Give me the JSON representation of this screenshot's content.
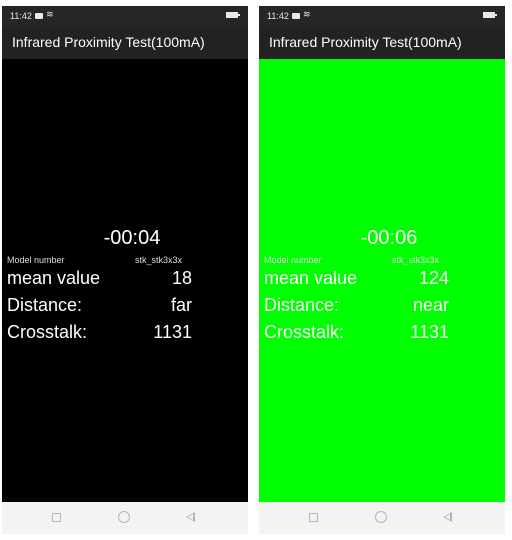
{
  "screens": [
    {
      "status_time": "11:42",
      "title": "Infrared Proximity Test(100mA)",
      "background_color": "#000000",
      "timer": "-00:04",
      "model_label": "Model number",
      "model_value": "stk_stk3x3x",
      "mean_label": "mean value",
      "mean_value": "18",
      "distance_label": "Distance:",
      "distance_value": "far",
      "crosstalk_label": "Crosstalk:",
      "crosstalk_value": "1131"
    },
    {
      "status_time": "11:42",
      "title": "Infrared Proximity Test(100mA)",
      "background_color": "#00ff00",
      "timer": "-00:06",
      "model_label": "Model number",
      "model_value": "stk_stk3x3x",
      "mean_label": "mean value",
      "mean_value": "124",
      "distance_label": "Distance:",
      "distance_value": "near",
      "crosstalk_label": "Crosstalk:",
      "crosstalk_value": "1131"
    }
  ],
  "icons": {
    "status": [
      "image-icon",
      "wifi-icon",
      "battery-icon"
    ],
    "nav": [
      "recent-apps-icon",
      "home-icon",
      "back-icon"
    ]
  }
}
